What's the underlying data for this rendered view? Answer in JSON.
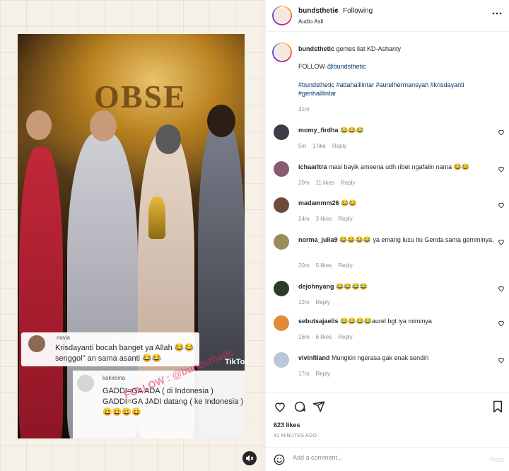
{
  "media": {
    "stage_text": "OBSE",
    "overlay_comment_1": {
      "user": "novia",
      "text": "Krisdayanti bocah banget ya Allah 😂😂 senggol\" an sama asanti 😂😂"
    },
    "overlay_comment_2": {
      "user": "kakireina",
      "text": "GADDI=GA ADA ( di Indonesia ) GADDI=GA JADI datang ( ke Indonesia ) 😀😀😀😀"
    },
    "watermark": "FOLLOW : @bundsthetic",
    "tiktok_mark": "TikTok"
  },
  "header": {
    "username": "bundsthetic",
    "separator": "•",
    "follow_status": "Following",
    "audio": "Audio Asli"
  },
  "caption": {
    "username": "bundsthetic",
    "text": "gemes liat KD-Ashanty",
    "follow_prefix": "FOLLOW ",
    "follow_mention": "@bundsthetic",
    "hashtags": "#bundsthetic #attahalilintar #aurelhermansyah #krisdayanti #genhalilintar",
    "time": "31m"
  },
  "comments": [
    {
      "user": "momy_firdha",
      "text": "😂😂😂",
      "time": "5m",
      "likes": "1 like",
      "reply": "Reply",
      "avatar_color": "#3b3f45"
    },
    {
      "user": "ichaaritra",
      "text": "masi bayik ameena udh ribet ngafalin nama 😂😂",
      "time": "20m",
      "likes": "11 likes",
      "reply": "Reply",
      "avatar_color": "#8a5a6e"
    },
    {
      "user": "madammm26",
      "text": "😂😂",
      "time": "24m",
      "likes": "3 likes",
      "reply": "Reply",
      "avatar_color": "#6e4a3a"
    },
    {
      "user": "norma_julia9",
      "text": "😂😂😂😂 ya emang lucu itu Genda sama gemminya.",
      "time": "20m",
      "likes": "5 likes",
      "reply": "Reply",
      "avatar_color": "#9c8a5a"
    },
    {
      "user": "dejohnyang",
      "text": "😂😂😂😂",
      "time": "12m",
      "likes": "",
      "reply": "Reply",
      "avatar_color": "#2f3a2c"
    },
    {
      "user": "sebutsajaelis",
      "text": "😂😂😂😂aurel bgt iya miminya",
      "time": "16m",
      "likes": "6 likes",
      "reply": "Reply",
      "avatar_color": "#e08a3a"
    },
    {
      "user": "vivinfiland",
      "text": "Mungkin ngerasa gak enak sendiri",
      "time": "17m",
      "likes": "",
      "reply": "Reply",
      "avatar_color": "#b9c7d6"
    }
  ],
  "actions": {
    "likes": "623 likes",
    "posted": "42 MINUTES AGO"
  },
  "add_comment": {
    "placeholder": "Add a comment...",
    "post": "Post"
  },
  "icons": {
    "more": "more-icon",
    "heart": "heart-icon",
    "comment": "comment-icon",
    "share": "share-icon",
    "save": "bookmark-icon",
    "emoji": "emoji-icon",
    "mute": "speaker-muted-icon"
  }
}
